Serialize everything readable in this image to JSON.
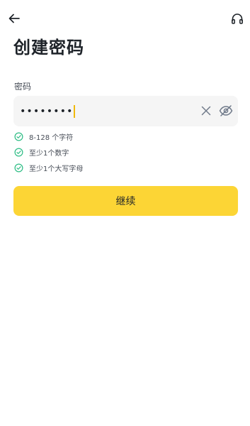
{
  "header": {
    "back_icon": "arrow-left-icon",
    "support_icon": "headset-icon"
  },
  "page": {
    "title": "创建密码"
  },
  "password": {
    "label": "密码",
    "value": "••••••••",
    "clear_icon": "close-icon",
    "visibility_icon": "eye-off-icon"
  },
  "requirements": [
    {
      "text": "8-128 个字符",
      "met": true
    },
    {
      "text": "至少1个数字",
      "met": true
    },
    {
      "text": "至少1个大写字母",
      "met": true
    }
  ],
  "actions": {
    "continue_label": "继续"
  },
  "colors": {
    "accent": "#fcd535",
    "caret": "#f0b90b",
    "check": "#2ebd85",
    "text_primary": "#1e2329",
    "text_secondary": "#474d57",
    "input_bg": "#f5f5f5"
  }
}
